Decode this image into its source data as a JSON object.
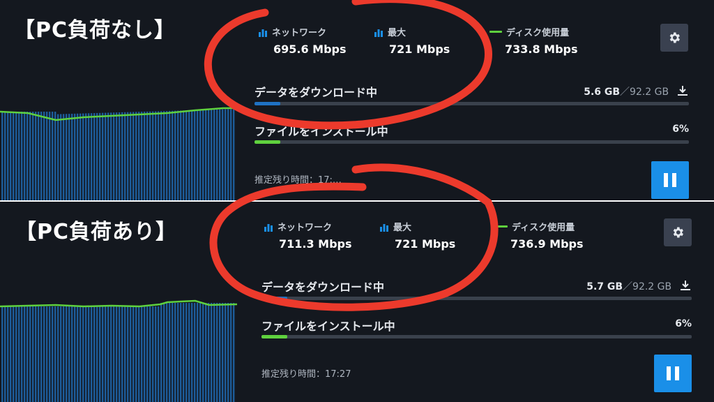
{
  "colors": {
    "accent_blue": "#1a8fe8",
    "graph_line": "#5fd13e",
    "annotation_red": "#ec3a2c"
  },
  "panels": [
    {
      "overlay_label": "【PC負荷なし】",
      "stats": {
        "network_label": "ネットワーク",
        "network_value": "695.6 Mbps",
        "peak_label": "最大",
        "peak_value": "721 Mbps",
        "disk_label": "ディスク使用量",
        "disk_value": "733.8 Mbps"
      },
      "download": {
        "label": "データをダウンロード中",
        "current": "5.6 GB",
        "total": "／92.2 GB",
        "progress": 0.06
      },
      "install": {
        "label": "ファイルをインストール中",
        "percent": "6%",
        "progress": 0.06
      },
      "eta": "推定残り時間：17:…"
    },
    {
      "overlay_label": "【PC負荷あり】",
      "stats": {
        "network_label": "ネットワーク",
        "network_value": "711.3 Mbps",
        "peak_label": "最大",
        "peak_value": "721 Mbps",
        "disk_label": "ディスク使用量",
        "disk_value": "736.9 Mbps"
      },
      "download": {
        "label": "データをダウンロード中",
        "current": "5.7 GB",
        "total": "／92.2 GB",
        "progress": 0.06
      },
      "install": {
        "label": "ファイルをインストール中",
        "percent": "6%",
        "progress": 0.06
      },
      "eta": "推定残り時間：17:27"
    }
  ],
  "icons": {
    "settings": "gear-icon",
    "download": "download-icon",
    "pause": "pause-icon",
    "network": "bar-chart-icon",
    "disk": "line-legend-icon"
  }
}
